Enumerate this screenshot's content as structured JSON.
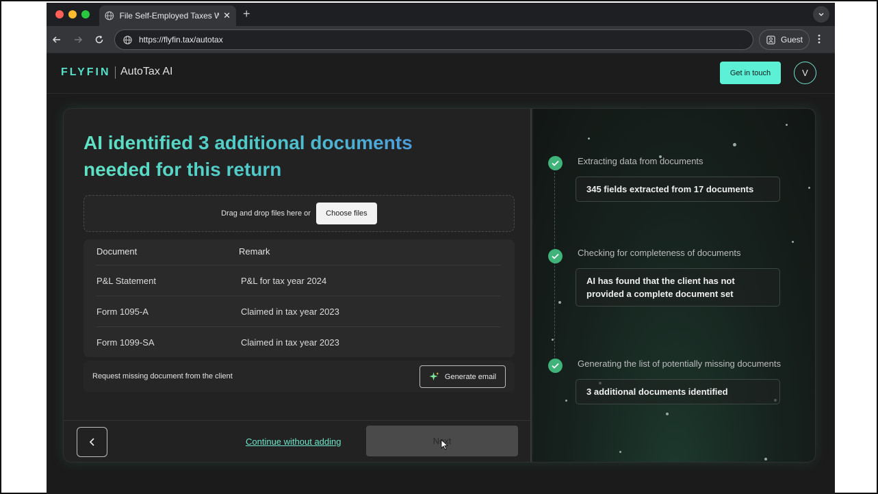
{
  "browser": {
    "tab_title": "File Self-Employed Taxes Wit",
    "url": "https://flyfin.tax/autotax",
    "profile_label": "Guest"
  },
  "header": {
    "logo": "FLYFIN",
    "product": "AutoTax AI",
    "cta": "Get in touch",
    "avatar_initial": "V"
  },
  "main": {
    "headline_line1": "AI identified 3 additional documents",
    "headline_line2": "needed for this return",
    "dropzone_text": "Drag and drop files here or",
    "choose_files": "Choose files",
    "table": {
      "headers": [
        "Document",
        "Remark"
      ],
      "rows": [
        {
          "document": "P&L Statement",
          "remark": "P&L for tax year 2024"
        },
        {
          "document": "Form 1095-A",
          "remark": "Claimed in tax year 2023"
        },
        {
          "document": "Form 1099-SA",
          "remark": "Claimed in tax year 2023"
        }
      ]
    },
    "request_text": "Request missing document from the client",
    "generate_email": "Generate email",
    "continue_without": "Continue without adding",
    "next": "Next"
  },
  "steps": [
    {
      "title": "Extracting data from documents",
      "detail": "345 fields extracted from 17 documents"
    },
    {
      "title": "Checking for completeness of documents",
      "detail": "AI has found that the client has not provided a complete document set"
    },
    {
      "title": "Generating the list of potentially missing documents",
      "detail": "3 additional documents identified"
    }
  ],
  "colors": {
    "accent": "#5cf0d6",
    "check": "#3fb37a",
    "link": "#6fe6c9"
  }
}
